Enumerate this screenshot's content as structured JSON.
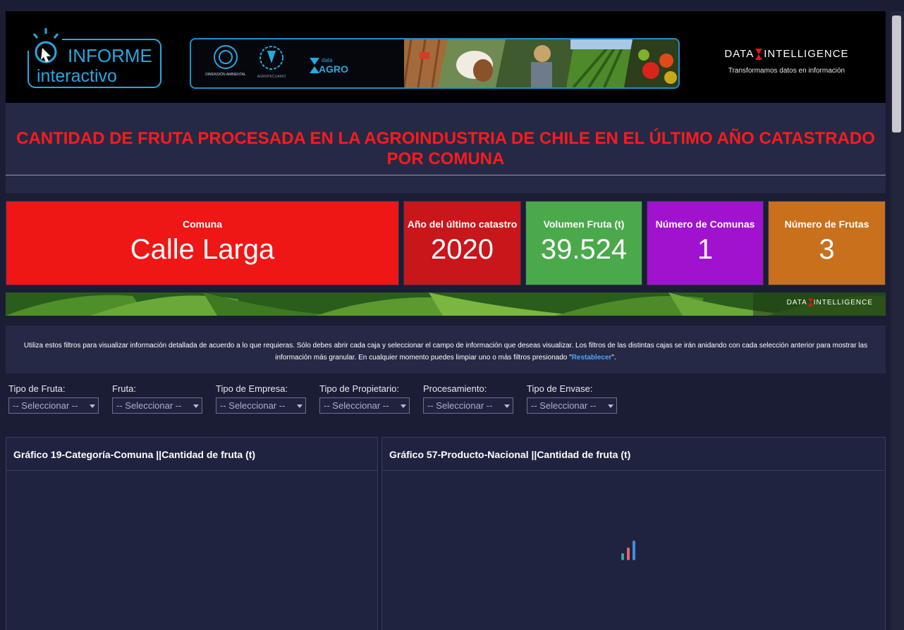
{
  "header": {
    "logo_top": "INFORME",
    "logo_bottom": "interactivo",
    "banner_logo_1": "DIMENSIÓN AMBIENTAL",
    "banner_logo_2": "AGROPECUARIO",
    "banner_logo_3_small": "data",
    "banner_logo_3_big": "AGRO",
    "brand_left": "DATA",
    "brand_right": "INTELLIGENCE",
    "brand_tagline": "Transformamos datos en información"
  },
  "title": "CANTIDAD DE FRUTA PROCESADA EN LA AGROINDUSTRIA DE CHILE EN EL ÚLTIMO AÑO CATASTRADO POR COMUNA",
  "kpis": [
    {
      "label": "Comuna",
      "value": "Calle Larga",
      "color": "#ef1616"
    },
    {
      "label": "Año del último catastro",
      "value": "2020",
      "color": "#c8161a"
    },
    {
      "label": "Volumen Fruta (t)",
      "value": "39.524",
      "color": "#4aa94a"
    },
    {
      "label": "Número de Comunas",
      "value": "1",
      "color": "#a112cf"
    },
    {
      "label": "Número de Frutas",
      "value": "3",
      "color": "#c9701c"
    }
  ],
  "leaf_brand": {
    "left": "DATA",
    "right": "INTELLIGENCE"
  },
  "info": {
    "text_before": "Utiliza estos filtros para visualizar información detallada de acuerdo a lo que requieras. Sólo debes abrir cada caja y seleccionar el campo de información que deseas visualizar. Los filtros de las distintas cajas se irán anidando con cada selección anterior para mostrar las información más granular. En cualquier momento puedes limpiar uno o más filtros presionado \"",
    "link": "Restablecer",
    "text_after": "\"."
  },
  "filters": [
    {
      "label": "Tipo de Fruta:",
      "value": "-- Seleccionar --"
    },
    {
      "label": "Fruta:",
      "value": "-- Seleccionar --"
    },
    {
      "label": "Tipo de Empresa:",
      "value": "-- Seleccionar --"
    },
    {
      "label": "Tipo de Propietario:",
      "value": "-- Seleccionar --"
    },
    {
      "label": "Procesamiento:",
      "value": "-- Seleccionar --"
    },
    {
      "label": "Tipo de Envase:",
      "value": "-- Seleccionar --"
    }
  ],
  "panels": {
    "left_title": "Gráfico 19-Categoría-Comuna ||Cantidad de fruta (t)",
    "right_title": "Gráfico 57-Producto-Nacional ||Cantidad de fruta (t)"
  },
  "colors": {
    "background": "#1b1d35",
    "title_red": "#ff1a1a",
    "banner_border": "#1e90c8",
    "link_blue": "#4da3ff"
  }
}
